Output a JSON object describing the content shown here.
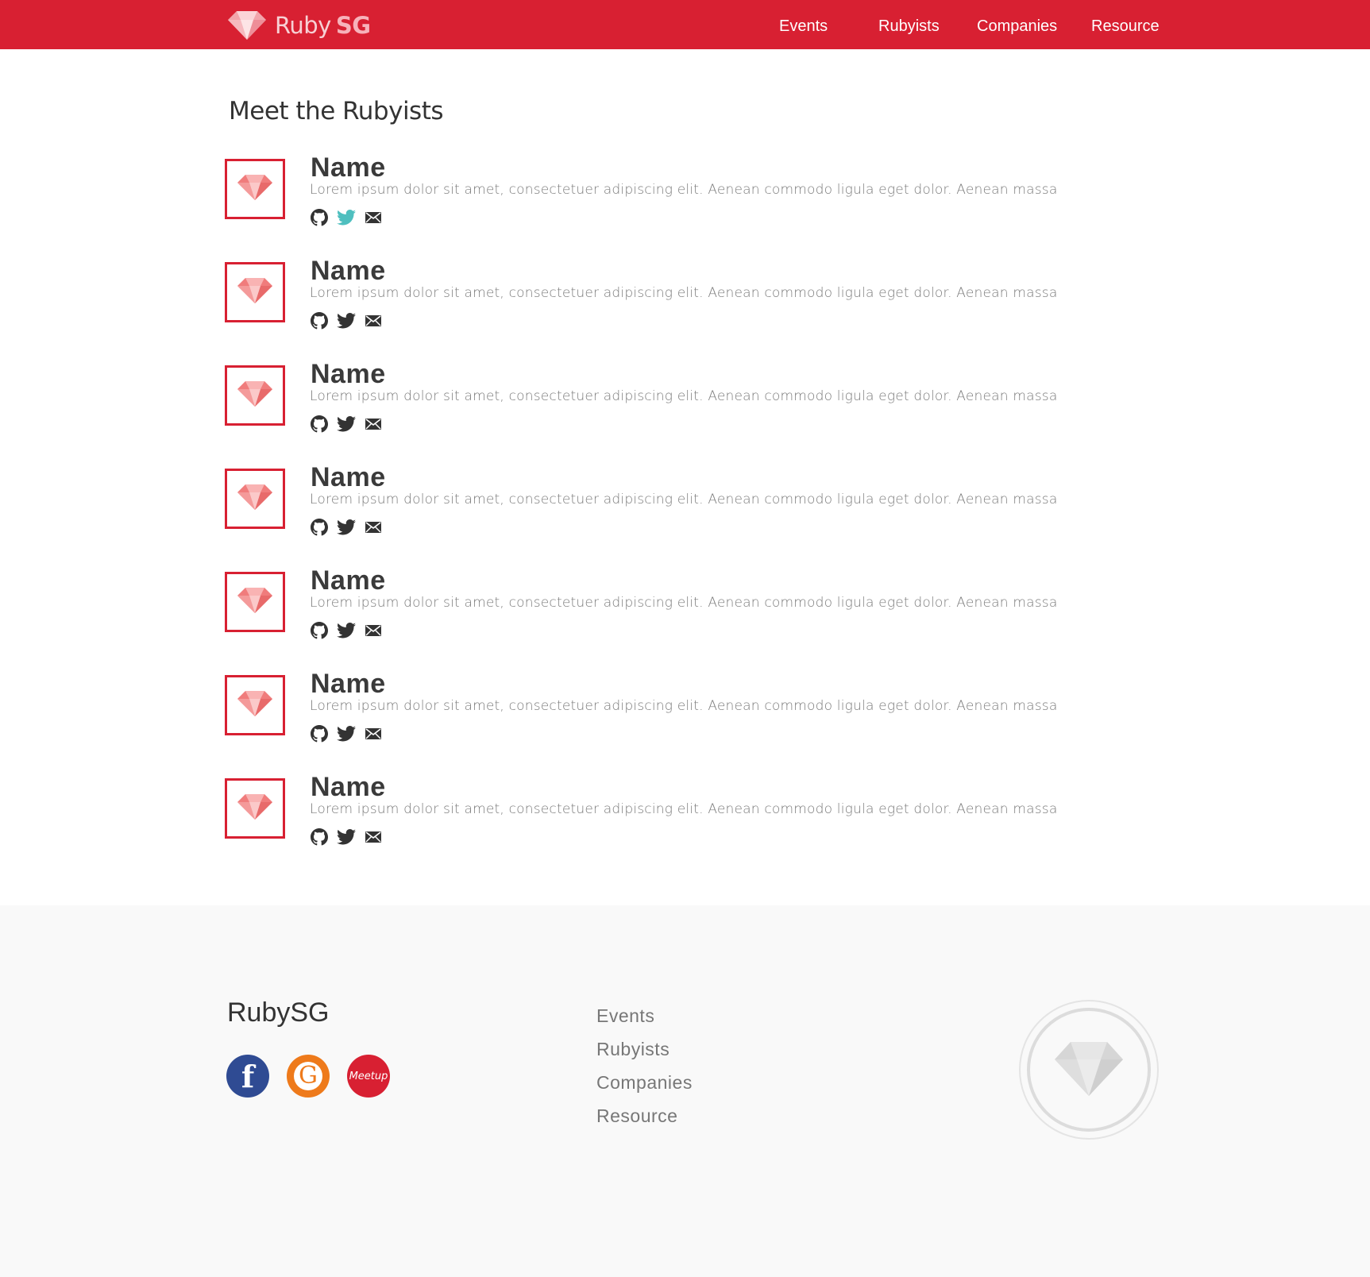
{
  "header": {
    "brand_text": "Ruby",
    "brand_suffix": "SG",
    "nav": [
      "Events",
      "Rubyists",
      "Companies",
      "Resource"
    ]
  },
  "main": {
    "title": "Meet the Rubyists",
    "rubyists": [
      {
        "name": "Name",
        "bio": "Lorem ipsum dolor sit amet, consectetuer adipiscing elit. Aenean commodo ligula eget dolor. Aenean massa",
        "twitter_active": true
      },
      {
        "name": "Name",
        "bio": "Lorem ipsum dolor sit amet, consectetuer adipiscing elit. Aenean commodo ligula eget dolor. Aenean massa",
        "twitter_active": false
      },
      {
        "name": "Name",
        "bio": "Lorem ipsum dolor sit amet, consectetuer adipiscing elit. Aenean commodo ligula eget dolor. Aenean massa",
        "twitter_active": false
      },
      {
        "name": "Name",
        "bio": "Lorem ipsum dolor sit amet, consectetuer adipiscing elit. Aenean commodo ligula eget dolor. Aenean massa",
        "twitter_active": false
      },
      {
        "name": "Name",
        "bio": "Lorem ipsum dolor sit amet, consectetuer adipiscing elit. Aenean commodo ligula eget dolor. Aenean massa",
        "twitter_active": false
      },
      {
        "name": "Name",
        "bio": "Lorem ipsum dolor sit amet, consectetuer adipiscing elit. Aenean commodo ligula eget dolor. Aenean massa",
        "twitter_active": false
      },
      {
        "name": "Name",
        "bio": "Lorem ipsum dolor sit amet, consectetuer adipiscing elit. Aenean commodo ligula eget dolor. Aenean massa",
        "twitter_active": false
      }
    ]
  },
  "footer": {
    "brand": "RubySG",
    "social": {
      "facebook_glyph": "f",
      "g_glyph": "G",
      "meetup_label": "Meetup"
    },
    "nav": [
      "Events",
      "Rubyists",
      "Companies",
      "Resource"
    ]
  },
  "colors": {
    "brand_red": "#d82032",
    "gem_pink": "#f08080",
    "twitter_active": "#4fbfbf",
    "icon_dark": "#333333",
    "footer_bg": "#f9f9f9",
    "facebook_blue": "#2f4b93",
    "g_orange": "#ee7a1b"
  },
  "icons": [
    "ruby-gem-icon",
    "github-icon",
    "twitter-icon",
    "mail-icon",
    "facebook-icon",
    "g-icon",
    "meetup-icon"
  ]
}
